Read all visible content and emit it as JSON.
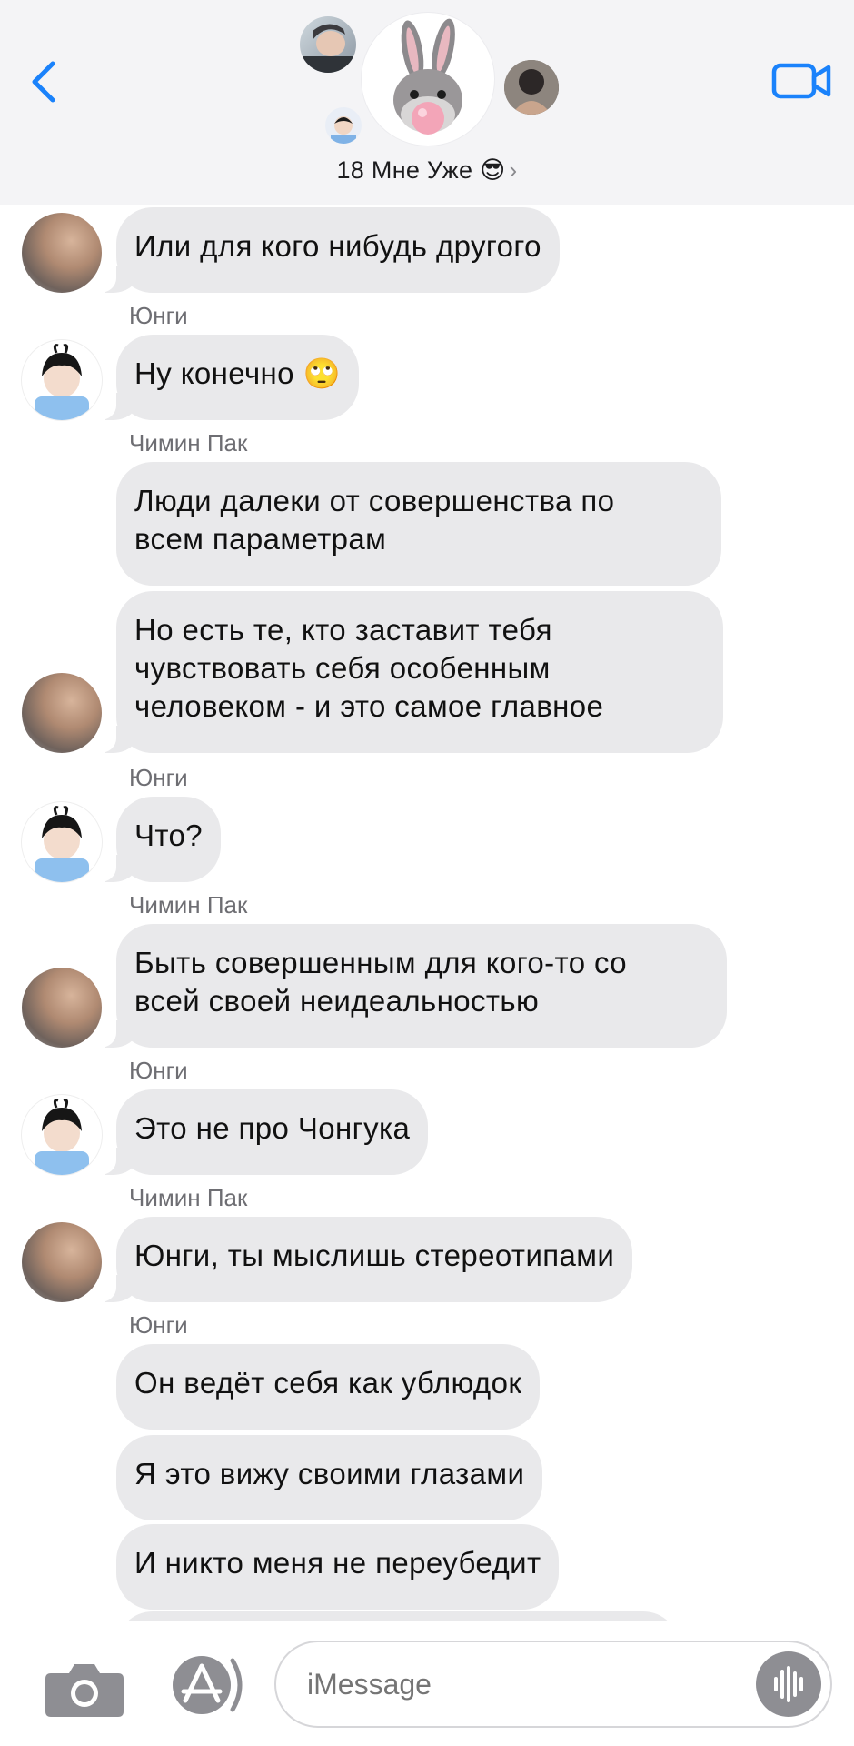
{
  "header": {
    "group_name": "18 Мне Уже 😎",
    "chevron": "›",
    "back_icon": "chevron-left-icon",
    "video_icon": "video-camera-icon"
  },
  "messages": [
    {
      "sender": "",
      "text": "Или для кого нибудь другого"
    },
    {
      "sender": "Юнги",
      "text": "Ну конечно 🙄"
    },
    {
      "sender": "Чимин Пак",
      "text": "Люди далеки от совершенства  по\nвсем параметрам"
    },
    {
      "sender": "",
      "text": "Но есть те, кто заставит тебя\nчувствовать  себя особенным\nчеловеком  - и это самое главное"
    },
    {
      "sender": "Юнги",
      "text": "Что?"
    },
    {
      "sender": "Чимин Пак",
      "text": "Быть совершенным для кого-то со\nвсей своей неидеальностью"
    },
    {
      "sender": "Юнги",
      "text": "Это не про Чонгука"
    },
    {
      "sender": "Чимин Пак",
      "text": "Юнги,  ты мыслишь стереотипами"
    },
    {
      "sender": "Юнги",
      "text": "Он ведёт себя  как ублюдок"
    },
    {
      "sender": "",
      "text": "Я это вижу своими глазами"
    },
    {
      "sender": "",
      "text": "И никто меня не переубедит"
    }
  ],
  "input": {
    "placeholder": "iMessage"
  },
  "colors": {
    "accent": "#1a82fb",
    "bubble": "#e9e9eb",
    "header_bg": "#f4f4f6",
    "sender_text": "#6e6e73"
  }
}
